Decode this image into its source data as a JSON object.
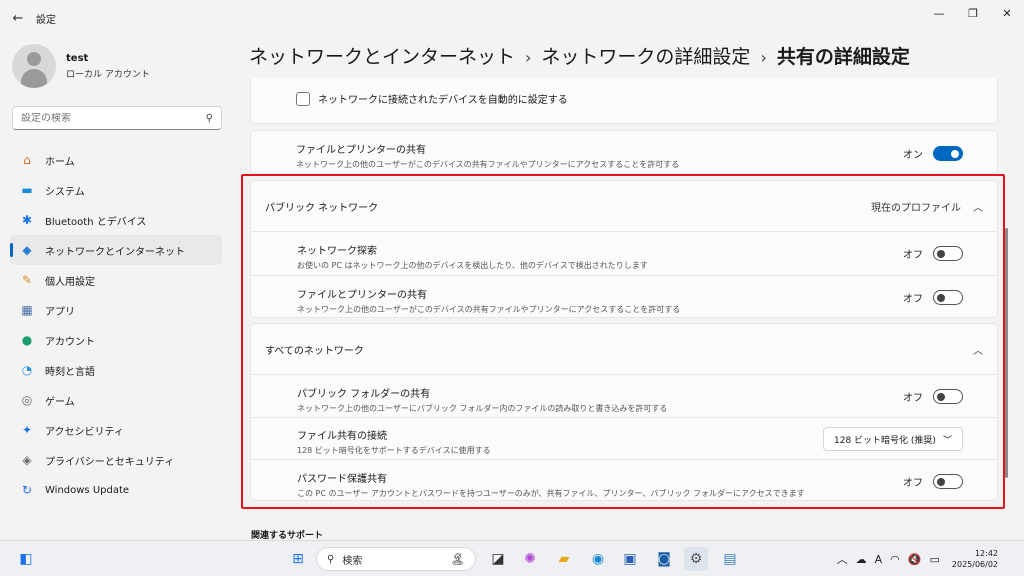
{
  "window": {
    "title": "設定"
  },
  "user": {
    "name": "test",
    "type": "ローカル アカウント"
  },
  "search": {
    "placeholder": "設定の検索"
  },
  "nav": [
    {
      "label": "ホーム",
      "icon": "home-icon",
      "glyph": "⌂",
      "color": "#d2691e"
    },
    {
      "label": "システム",
      "icon": "system-icon",
      "glyph": "▬",
      "color": "#1a8ad4"
    },
    {
      "label": "Bluetooth とデバイス",
      "icon": "bluetooth-icon",
      "glyph": "✱",
      "color": "#1a73e8"
    },
    {
      "label": "ネットワークとインターネット",
      "icon": "network-icon",
      "glyph": "◆",
      "color": "#2a7fd4"
    },
    {
      "label": "個人用設定",
      "icon": "brush-icon",
      "glyph": "✎",
      "color": "#d48a2a"
    },
    {
      "label": "アプリ",
      "icon": "apps-icon",
      "glyph": "▦",
      "color": "#4a6fa5"
    },
    {
      "label": "アカウント",
      "icon": "account-icon",
      "glyph": "●",
      "color": "#1a9e6e"
    },
    {
      "label": "時刻と言語",
      "icon": "clock-globe-icon",
      "glyph": "◔",
      "color": "#2a8fd4"
    },
    {
      "label": "ゲーム",
      "icon": "gamepad-icon",
      "glyph": "◎",
      "color": "#666666"
    },
    {
      "label": "アクセシビリティ",
      "icon": "accessibility-icon",
      "glyph": "✦",
      "color": "#1a73e8"
    },
    {
      "label": "プライバシーとセキュリティ",
      "icon": "shield-icon",
      "glyph": "◈",
      "color": "#666666"
    },
    {
      "label": "Windows Update",
      "icon": "update-icon",
      "glyph": "↻",
      "color": "#1a73e8"
    }
  ],
  "breadcrumb": {
    "level1": "ネットワークとインターネット",
    "level2": "ネットワークの詳細設定",
    "current": "共有の詳細設定",
    "sep": "›"
  },
  "top": {
    "auto_setup": "ネットワークに接続されたデバイスを自動的に設定する",
    "file_share_title": "ファイルとプリンターの共有",
    "file_share_desc": "ネットワーク上の他のユーザーがこのデバイスの共有ファイルやプリンターにアクセスすることを許可する",
    "file_share_state": "オン"
  },
  "public": {
    "title": "パブリック ネットワーク",
    "profile": "現在のプロファイル",
    "discovery_title": "ネットワーク探索",
    "discovery_desc": "お使いの PC はネットワーク上の他のデバイスを検出したり、他のデバイスで検出されたりします",
    "discovery_state": "オフ",
    "file_share_title": "ファイルとプリンターの共有",
    "file_share_desc": "ネットワーク上の他のユーザーがこのデバイスの共有ファイルやプリンターにアクセスすることを許可する",
    "file_share_state": "オフ"
  },
  "all": {
    "title": "すべてのネットワーク",
    "public_folder_title": "パブリック フォルダーの共有",
    "public_folder_desc": "ネットワーク上の他のユーザーにパブリック フォルダー内のファイルの読み取りと書き込みを許可する",
    "public_folder_state": "オフ",
    "conn_title": "ファイル共有の接続",
    "conn_desc": "128 ビット暗号化をサポートするデバイスに使用する",
    "conn_value": "128 ビット暗号化 (推奨)",
    "pw_title": "パスワード保護共有",
    "pw_desc": "この PC のユーザー アカウントとパスワードを持つユーザーのみが、共有ファイル、プリンター、パブリック フォルダーにアクセスできます",
    "pw_state": "オフ"
  },
  "related": {
    "title": "関連するサポート"
  },
  "taskbar": {
    "search_label": "検索",
    "time": "12:42",
    "date": "2025/06/02",
    "ime": "A"
  },
  "colors": {
    "accent": "#0067c0",
    "highlight": "#e0161b"
  }
}
